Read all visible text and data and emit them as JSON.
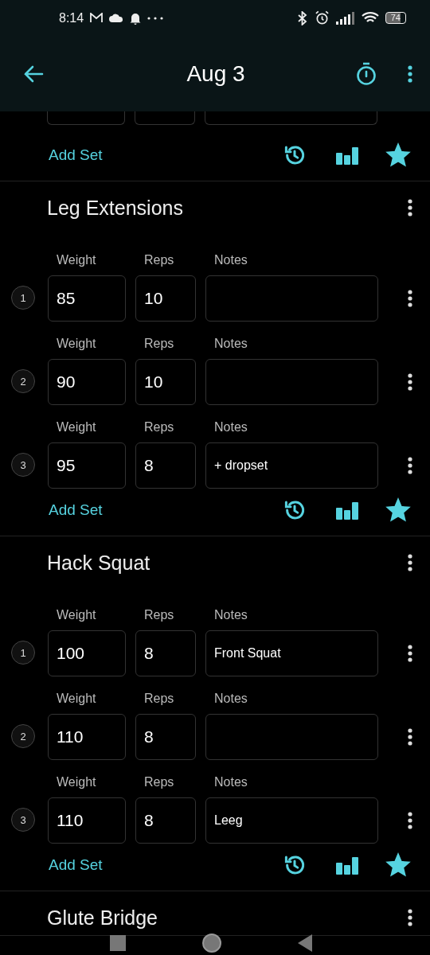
{
  "status_bar": {
    "time": "8:14",
    "battery": "74"
  },
  "app_bar": {
    "title": "Aug 3"
  },
  "exercises": [
    {
      "kind": "cut",
      "sets": [
        {
          "kind": "cut"
        }
      ],
      "add_label": "Add Set",
      "favorite": true
    },
    {
      "kind": "full",
      "title": "Leg Extensions",
      "add_label": "Add Set",
      "favorite": true,
      "sets": [
        {
          "kind": "full",
          "number": "1",
          "weight_label": "Weight",
          "reps_label": "Reps",
          "notes_label": "Notes",
          "weight": "85",
          "reps": "10"
        },
        {
          "kind": "full",
          "number": "2",
          "weight_label": "Weight",
          "reps_label": "Reps",
          "notes_label": "Notes",
          "weight": "90",
          "reps": "10"
        },
        {
          "kind": "full",
          "number": "3",
          "weight_label": "Weight",
          "reps_label": "Reps",
          "notes_label": "Notes",
          "weight": "95",
          "reps": "8",
          "notes": "+ dropset"
        }
      ]
    },
    {
      "kind": "full",
      "title": "Hack Squat",
      "add_label": "Add Set",
      "favorite": true,
      "sets": [
        {
          "kind": "full",
          "number": "1",
          "weight_label": "Weight",
          "reps_label": "Reps",
          "notes_label": "Notes",
          "weight": "100",
          "reps": "8",
          "notes": "Front Squat"
        },
        {
          "kind": "full",
          "number": "2",
          "weight_label": "Weight",
          "reps_label": "Reps",
          "notes_label": "Notes",
          "weight": "110",
          "reps": "8"
        },
        {
          "kind": "full",
          "number": "3",
          "weight_label": "Weight",
          "reps_label": "Reps",
          "notes_label": "Notes",
          "weight": "110",
          "reps": "8",
          "notes": "Leeg"
        }
      ]
    },
    {
      "kind": "title_only",
      "title": "Glute Bridge"
    }
  ]
}
